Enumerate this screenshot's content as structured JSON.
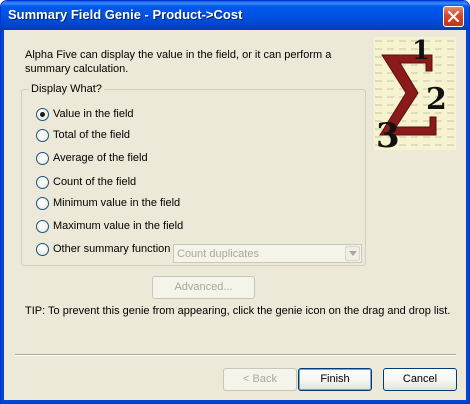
{
  "window": {
    "title": "Summary Field Genie - Product->Cost"
  },
  "intro_text": "Alpha Five can display the value in the field, or it can perform a summary calculation.",
  "group": {
    "label": "Display What?",
    "options": [
      {
        "label": "Value in the field",
        "checked": true
      },
      {
        "label": "Total of the field",
        "checked": false
      },
      {
        "label": "Average of the field",
        "checked": false
      },
      {
        "label": "Count of the field",
        "checked": false
      },
      {
        "label": "Minimum value in the field",
        "checked": false
      },
      {
        "label": "Maximum value in the field",
        "checked": false
      },
      {
        "label": "Other summary function",
        "checked": false
      }
    ],
    "summary_function_select": {
      "value": "Count duplicates",
      "enabled": false
    }
  },
  "advanced_button": {
    "label": "Advanced...",
    "enabled": false
  },
  "tip_text": "TIP: To prevent this genie from appearing, click the genie icon on the drag and drop list.",
  "buttons": {
    "back": {
      "label": "< Back",
      "enabled": false
    },
    "finish": {
      "label": "Finish",
      "default": true
    },
    "cancel": {
      "label": "Cancel"
    }
  },
  "colors": {
    "titlebar": "#0054e3",
    "dialog_bg": "#ece9d8",
    "close_button": "#d9462a",
    "disabled_text": "#aca899",
    "genie_sigma": "#8b1a1a"
  },
  "icons": [
    "close-icon",
    "sigma-genie-icon",
    "dropdown-arrow-icon"
  ]
}
